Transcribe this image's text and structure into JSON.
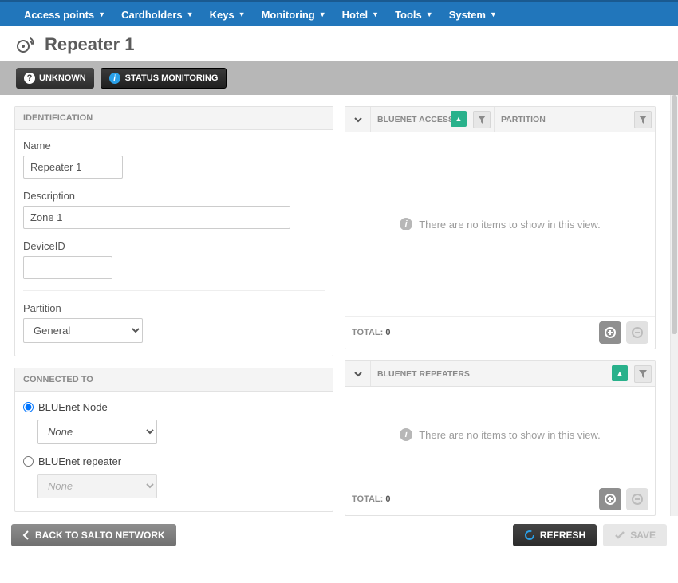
{
  "nav": {
    "items": [
      {
        "label": "Access points"
      },
      {
        "label": "Cardholders"
      },
      {
        "label": "Keys"
      },
      {
        "label": "Monitoring"
      },
      {
        "label": "Hotel"
      },
      {
        "label": "Tools"
      },
      {
        "label": "System"
      }
    ]
  },
  "page": {
    "title": "Repeater 1"
  },
  "status": {
    "unknown": "UNKNOWN",
    "monitoring": "STATUS MONITORING"
  },
  "identification": {
    "heading": "IDENTIFICATION",
    "name_label": "Name",
    "name_value": "Repeater 1",
    "desc_label": "Description",
    "desc_value": "Zone 1",
    "deviceid_label": "DeviceID",
    "deviceid_value": "",
    "partition_label": "Partition",
    "partition_value": "General"
  },
  "connected": {
    "heading": "CONNECTED TO",
    "node_label": "BLUEnet Node",
    "node_selected": true,
    "node_value": "None",
    "repeater_label": "BLUEnet repeater",
    "repeater_selected": false,
    "repeater_value": "None"
  },
  "grids": {
    "access": {
      "col1": "BLUENET ACCESS POINT",
      "col2": "PARTITION",
      "empty": "There are no items to show in this view.",
      "total_label": "TOTAL:",
      "total_value": "0"
    },
    "repeaters": {
      "col1": "BLUENET REPEATERS",
      "empty": "There are no items to show in this view.",
      "total_label": "TOTAL:",
      "total_value": "0"
    }
  },
  "footer": {
    "back": "BACK TO SALTO NETWORK",
    "refresh": "REFRESH",
    "save": "SAVE"
  }
}
